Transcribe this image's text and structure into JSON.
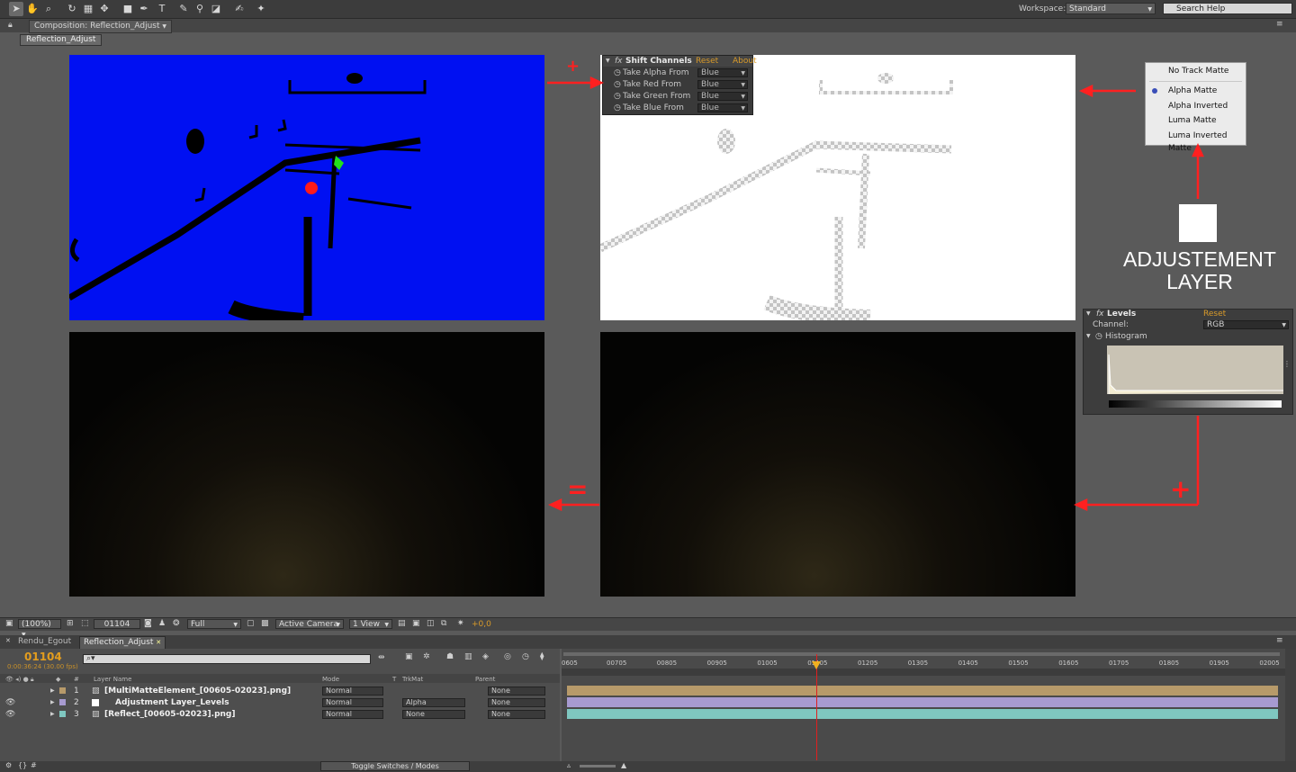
{
  "toolbar": {
    "workspace_label": "Workspace:",
    "workspace_value": "Standard",
    "search_placeholder": "Search Help"
  },
  "comp_panel": {
    "tab_title": "Composition: Reflection_Adjust",
    "viewer_name": "Reflection_Adjust"
  },
  "shift_channels": {
    "title": "Shift Channels",
    "reset": "Reset",
    "about": "About",
    "rows": [
      {
        "label": "Take Alpha From",
        "value": "Blue"
      },
      {
        "label": "Take Red From",
        "value": "Blue"
      },
      {
        "label": "Take Green From",
        "value": "Blue"
      },
      {
        "label": "Take Blue From",
        "value": "Blue"
      }
    ]
  },
  "track_matte_menu": {
    "items": [
      "No Track Matte",
      "Alpha Matte",
      "Alpha Inverted",
      "Luma Matte",
      "Luma Inverted Matte"
    ],
    "selected": "Alpha Matte"
  },
  "annotation": {
    "adjustment_line1": "ADJUSTEMENT",
    "adjustment_line2": "LAYER",
    "plus": "+",
    "equals": "="
  },
  "levels": {
    "title": "Levels",
    "reset": "Reset",
    "channel_label": "Channel:",
    "channel_value": "RGB",
    "histogram_label": "Histogram"
  },
  "viewer_controls": {
    "zoom": "(100%)",
    "timecode": "01104",
    "resolution": "Full",
    "camera": "Active Camera",
    "views": "1 View",
    "exposure": "+0,0"
  },
  "timeline": {
    "tabs": [
      "Rendu_Egout",
      "Reflection_Adjust"
    ],
    "timecode": "01104",
    "subtimecode": "0:00:36:24 (30.00 fps)",
    "columns": {
      "layer_name": "Layer Name",
      "mode": "Mode",
      "t": "T",
      "trkmat": "TrkMat",
      "parent": "Parent"
    },
    "layers": [
      {
        "num": "1",
        "name": "[MultiMatteElement_[00605-02023].png]",
        "mode": "Normal",
        "trkmat": "",
        "parent": "None",
        "color": "#b79a6a"
      },
      {
        "num": "2",
        "name": "Adjustment Layer_Levels",
        "mode": "Normal",
        "trkmat": "Alpha",
        "parent": "None",
        "color": "#a79ad0"
      },
      {
        "num": "3",
        "name": "[Reflect_[00605-02023].png]",
        "mode": "Normal",
        "trkmat": "None",
        "parent": "None",
        "color": "#7fc7c0"
      }
    ],
    "ruler": [
      "0605",
      "00705",
      "00805",
      "00905",
      "01005",
      "01105",
      "01205",
      "01305",
      "01405",
      "01505",
      "01605",
      "01705",
      "01805",
      "01905",
      "02005"
    ],
    "toggle_button": "Toggle Switches / Modes"
  }
}
